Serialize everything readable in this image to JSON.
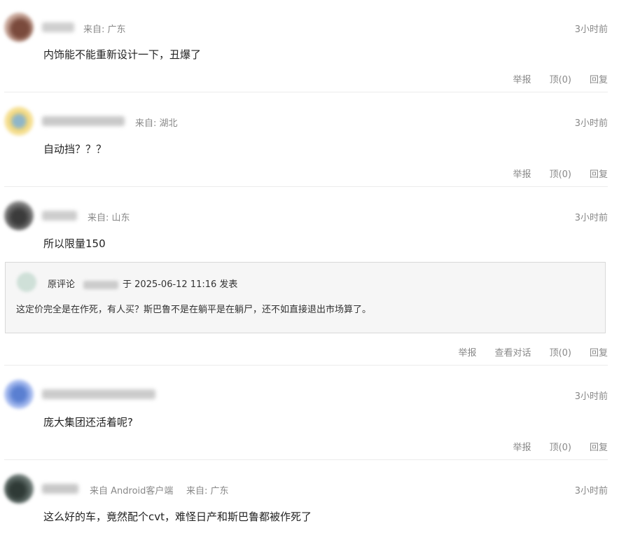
{
  "comments": [
    {
      "origin": "来自: 广东",
      "time": "3小时前",
      "content": "内饰能不能重新设计一下，丑爆了",
      "actions": [
        "举报",
        "顶(0)",
        "回复"
      ]
    },
    {
      "origin": "来自: 湖北",
      "time": "3小时前",
      "content": "自动挡？？？",
      "actions": [
        "举报",
        "顶(0)",
        "回复"
      ]
    },
    {
      "origin": "来自: 山东",
      "time": "3小时前",
      "content": "所以限量150",
      "quote": {
        "label": "原评论",
        "date_text": "于 2025-06-12 11:16  发表",
        "body": "这定价完全是在作死，有人买？斯巴鲁不是在躺平是在躺尸，还不如直接退出市场算了。"
      },
      "actions": [
        "举报",
        "查看对话",
        "顶(0)",
        "回复"
      ]
    },
    {
      "time": "3小时前",
      "content": "庞大集团还活着呢?",
      "actions": [
        "举报",
        "顶(0)",
        "回复"
      ]
    },
    {
      "client": "来自 Android客户端",
      "origin": "来自: 广东",
      "time": "3小时前",
      "content": "这么好的车，竟然配个cvt，难怪日产和斯巴鲁都被作死了"
    }
  ],
  "colors": {
    "meta_text": "#888888",
    "content_text": "#222222",
    "divider": "#ececec",
    "quote_bg": "#f6f6f6",
    "quote_border": "#d9d9d9"
  }
}
